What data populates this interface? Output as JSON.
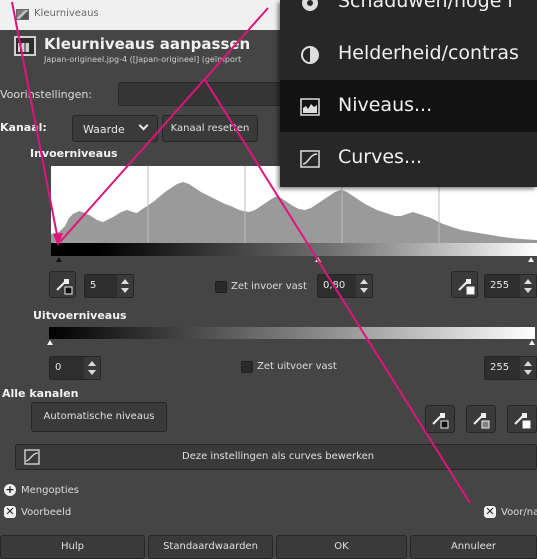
{
  "title_bar": {
    "title": "Kleurniveaus"
  },
  "dialog": {
    "heading": "Kleurniveaus aanpassen",
    "subheading": "Japan-origineel.jpg-4 ([Japan-origineel] (geïmport"
  },
  "presets": {
    "label": "Voorinstellingen:"
  },
  "channel": {
    "label": "Kanaal:",
    "value": "Waarde",
    "reset_label": "Kanaal resetten"
  },
  "input_levels": {
    "label": "Invoerniveaus",
    "low": "5",
    "gamma_label": "Zet invoer vast",
    "gamma": "0,80",
    "high": "255"
  },
  "output_levels": {
    "label": "Uitvoerniveaus",
    "low": "0",
    "lock_label": "Zet uitvoer vast",
    "high": "255"
  },
  "all_channels": {
    "label": "Alle kanalen",
    "auto_label": "Automatische niveaus"
  },
  "curves_button": {
    "label": "Deze instellingen als curves bewerken"
  },
  "blend": {
    "label": "Mengopties"
  },
  "preview": {
    "label": "Voorbeeld"
  },
  "split": {
    "label": "Voor/na"
  },
  "footer": {
    "help": "Hulp",
    "defaults": "Standaardwaarden",
    "ok": "OK",
    "cancel": "Annuleer"
  },
  "menu": {
    "items": [
      {
        "label": "Schaduwen/hoge l",
        "icon": "shadows-highlights-icon"
      },
      {
        "label": "Helderheid/contras",
        "icon": "brightness-contrast-icon"
      },
      {
        "label": "Niveaus...",
        "icon": "levels-icon",
        "selected": true
      },
      {
        "label": "Curves...",
        "icon": "curves-icon"
      }
    ]
  },
  "colors": {
    "annotation": "#e0147c",
    "menu_bg": "#272727",
    "dialog_bg": "#454545"
  }
}
